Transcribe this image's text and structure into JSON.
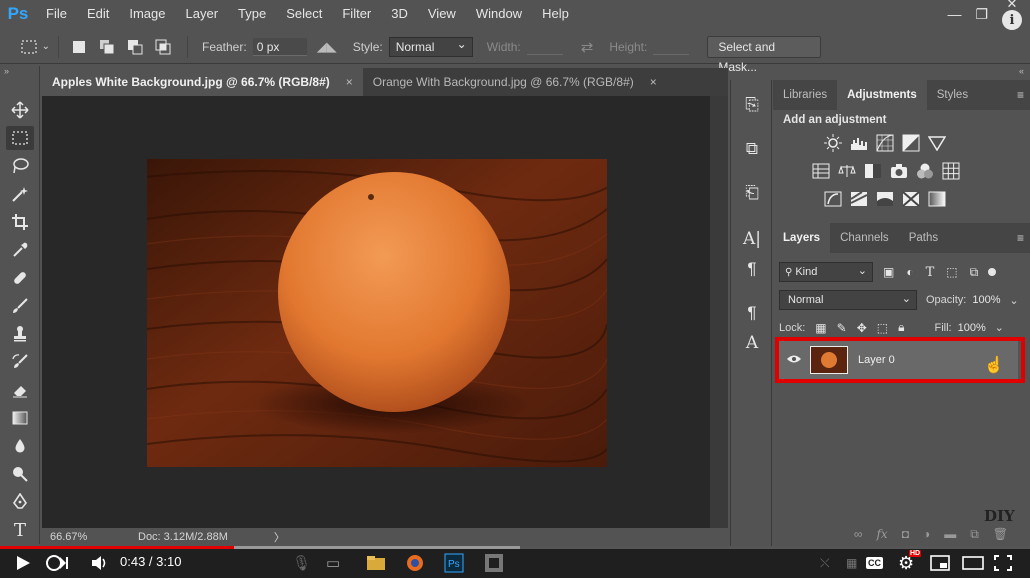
{
  "app": {
    "logo": "Ps"
  },
  "menu": [
    "File",
    "Edit",
    "Image",
    "Layer",
    "Type",
    "Select",
    "Filter",
    "3D",
    "View",
    "Window",
    "Help"
  ],
  "options": {
    "feather_label": "Feather:",
    "feather_value": "0 px",
    "style_label": "Style:",
    "style_value": "Normal",
    "width_label": "Width:",
    "height_label": "Height:",
    "select_mask_label": "Select and Mask..."
  },
  "tabs": [
    {
      "title": "Apples White Background.jpg @ 66.7% (RGB/8#)",
      "close": "×"
    },
    {
      "title": "Orange With Background.jpg @ 66.7% (RGB/8#)",
      "close": "×"
    }
  ],
  "status": {
    "zoom": "66.67%",
    "doc": "Doc: 3.12M/2.88M",
    "arrow": "〉"
  },
  "panel_top": {
    "tabs": [
      "Libraries",
      "Adjustments",
      "Styles"
    ],
    "add_label": "Add an adjustment"
  },
  "layers_panel": {
    "tabs": [
      "Layers",
      "Channels",
      "Paths"
    ],
    "kind_label": "Kind",
    "blend_mode": "Normal",
    "opacity_label": "Opacity:",
    "opacity_value": "100%",
    "lock_label": "Lock:",
    "fill_label": "Fill:",
    "fill_value": "100%",
    "layer_name": "Layer 0",
    "highlight_color": "#e00000"
  },
  "video": {
    "time": "0:43 / 3:10",
    "progress_played": 0.227,
    "progress_buffered": 0.505,
    "hd_badge": "HD",
    "cc_label": "CC"
  },
  "watermark": "DIY",
  "colors": {
    "accent": "#31a8ff",
    "progress": "#e00000",
    "ui_bg": "#535353",
    "canvas_bg": "#282828"
  }
}
